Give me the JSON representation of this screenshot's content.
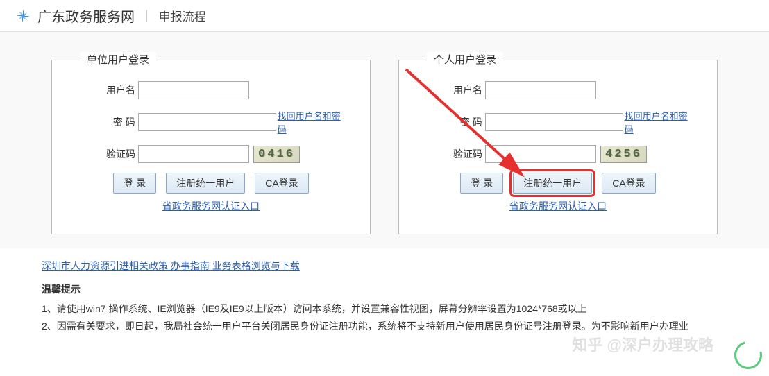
{
  "header": {
    "site_title": "广东政务服务网",
    "page_subtitle": "申报流程"
  },
  "left_box": {
    "title": "单位用户登录",
    "username_label": "用户名",
    "password_label": "密  码",
    "captcha_label": "验证码",
    "captcha_value": "0416",
    "forgot_link": "找回用户名和密码",
    "login_btn": "登 录",
    "register_btn": "注册统一用户",
    "ca_login_btn": "CA登录",
    "service_link": "省政务服务网认证入口"
  },
  "right_box": {
    "title": "个人用户登录",
    "username_label": "用户名",
    "password_label": "密  码",
    "captcha_label": "验证码",
    "captcha_value": "4256",
    "forgot_link": "找回用户名和密码",
    "login_btn": "登 录",
    "register_btn": "注册统一用户",
    "ca_login_btn": "CA登录",
    "service_link": "省政务服务网认证入口"
  },
  "links": {
    "main_link": "深圳市人力资源引进相关政策  办事指南  业务表格浏览与下载"
  },
  "tips": {
    "title": "温馨提示",
    "items": [
      "1、请使用win7 操作系统、IE浏览器（IE9及IE9以上版本）访问本系统，并设置兼容性视图，屏幕分辨率设置为1024*768或以上",
      "2、因需有关要求，即日起，我局社会统一用户平台关闭居民身份证注册功能，系统将不支持新用户使用居民身份证号注册登录。为不影响新用户办理业"
    ]
  },
  "watermark": "知乎 @深户办理攻略"
}
